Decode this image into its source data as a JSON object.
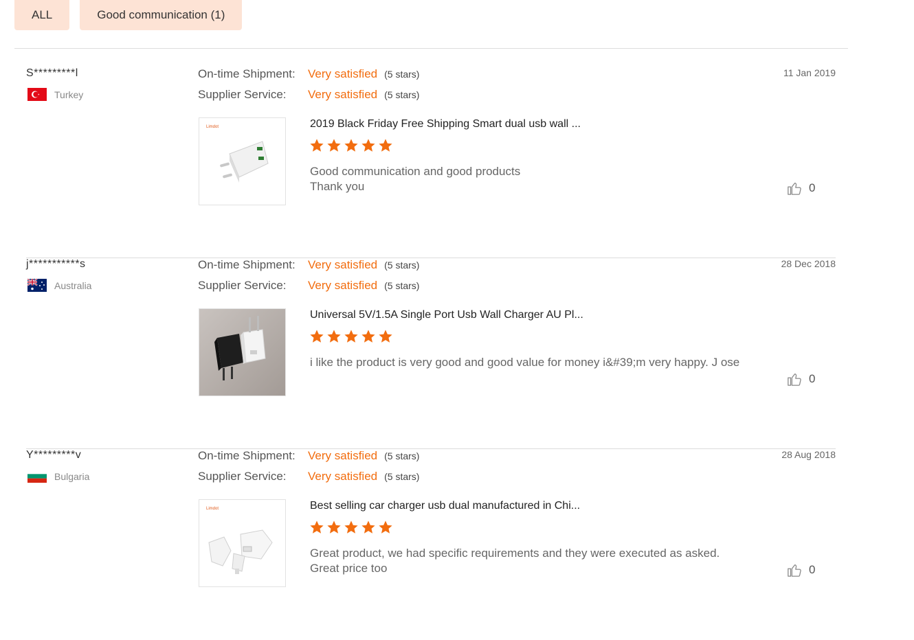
{
  "filters": [
    {
      "label": "ALL"
    },
    {
      "label": "Good communication (1)"
    }
  ],
  "labels": {
    "shipment": "On-time Shipment:",
    "service": "Supplier Service:"
  },
  "colors": {
    "accent": "#f26d0f",
    "chip_bg": "#fde3d5"
  },
  "reviews": [
    {
      "buyer": "S*********l",
      "country": "Turkey",
      "flag_icon": "turkey-flag-icon",
      "date": "11 Jan 2019",
      "shipment_value": "Very satisfied",
      "shipment_stars": "(5 stars)",
      "service_value": "Very satisfied",
      "service_stars": "(5 stars)",
      "product_title": "2019 Black Friday Free Shipping Smart dual usb wall ...",
      "product_image": "white-dual-usb-wall-charger",
      "product_image_brand": "Limdot",
      "rating": 5,
      "comment": "Good communication and good products\nThank you",
      "likes": "0"
    },
    {
      "buyer": "j***********s",
      "country": "Australia",
      "flag_icon": "australia-flag-icon",
      "date": "28 Dec 2018",
      "shipment_value": "Very satisfied",
      "shipment_stars": "(5 stars)",
      "service_value": "Very satisfied",
      "service_stars": "(5 stars)",
      "product_title": "Universal 5V/1.5A Single Port Usb Wall Charger AU Pl...",
      "product_image": "photo-black-and-white-wall-chargers",
      "rating": 5,
      "comment": "i like the product is very good and good value for money i&#39;m very happy. J ose",
      "likes": "0"
    },
    {
      "buyer": "Y*********v",
      "country": "Bulgaria",
      "flag_icon": "bulgaria-flag-icon",
      "date": "28 Aug 2018",
      "shipment_value": "Very satisfied",
      "shipment_stars": "(5 stars)",
      "service_value": "Very satisfied",
      "service_stars": "(5 stars)",
      "product_title": "Best selling car charger usb dual manufactured in Chi...",
      "product_image": "white-car-charger-dual-usb",
      "product_image_brand": "Limdot",
      "rating": 5,
      "comment": "Great product, we had specific requirements and they were executed as asked.\nGreat price too",
      "likes": "0"
    }
  ]
}
